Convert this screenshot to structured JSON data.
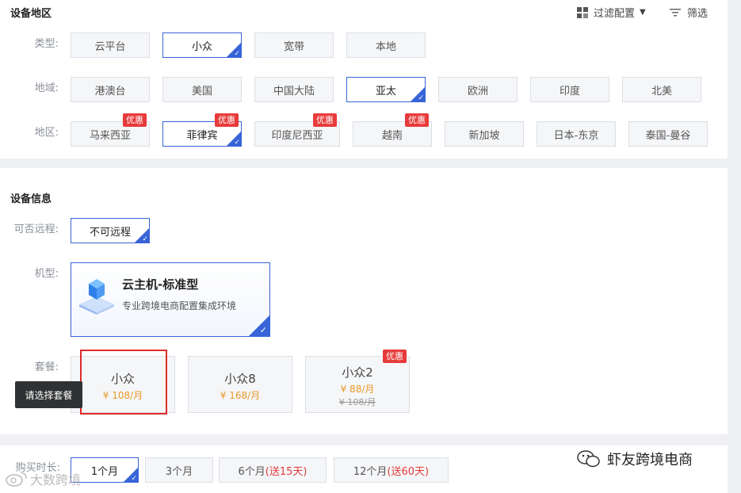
{
  "region_section": {
    "title": "设备地区",
    "filter_config_label": "过滤配置",
    "filter_label": "筛选",
    "type_label": "类型:",
    "types": [
      {
        "label": "云平台",
        "selected": false
      },
      {
        "label": "小众",
        "selected": true
      },
      {
        "label": "宽带",
        "selected": false
      },
      {
        "label": "本地",
        "selected": false
      }
    ],
    "area_label": "地域:",
    "areas": [
      {
        "label": "港澳台",
        "selected": false
      },
      {
        "label": "美国",
        "selected": false
      },
      {
        "label": "中国大陆",
        "selected": false
      },
      {
        "label": "亚太",
        "selected": true
      },
      {
        "label": "欧洲",
        "selected": false
      },
      {
        "label": "印度",
        "selected": false
      },
      {
        "label": "北美",
        "selected": false
      }
    ],
    "district_label": "地区:",
    "districts": [
      {
        "label": "马来西亚",
        "badge": "优惠",
        "selected": false
      },
      {
        "label": "菲律宾",
        "badge": "优惠",
        "selected": true
      },
      {
        "label": "印度尼西亚",
        "badge": "优惠",
        "selected": false
      },
      {
        "label": "越南",
        "badge": "优惠",
        "selected": false
      },
      {
        "label": "新加坡",
        "badge": "",
        "selected": false
      },
      {
        "label": "日本-东京",
        "badge": "",
        "selected": false
      },
      {
        "label": "泰国-曼谷",
        "badge": "",
        "selected": false
      }
    ]
  },
  "device_section": {
    "title": "设备信息",
    "remote_label": "可否远程:",
    "remote_value": "不可远程",
    "model_label": "机型:",
    "model": {
      "name": "云主机-标准型",
      "desc": "专业跨境电商配置集成环境"
    },
    "package_label": "套餐:",
    "packages": [
      {
        "name": "小众",
        "price": "¥ 108/月",
        "old_price": "",
        "badge": ""
      },
      {
        "name": "小众8",
        "price": "¥ 168/月",
        "old_price": "",
        "badge": ""
      },
      {
        "name": "小众2",
        "price": "¥ 88/月",
        "old_price": "¥ 108/月",
        "badge": "优惠"
      }
    ],
    "tooltip": "请选择套餐"
  },
  "duration_section": {
    "label": "购买时长:",
    "options": [
      {
        "label": "1个月",
        "extra": "",
        "selected": true
      },
      {
        "label": "3个月",
        "extra": "",
        "selected": false
      },
      {
        "label": "6个月",
        "extra": "(送15天)",
        "selected": false
      },
      {
        "label": "12个月",
        "extra": "(送60天)",
        "selected": false
      }
    ]
  },
  "watermarks": {
    "wechat": "虾友跨境电商",
    "weibo": "大数跨境"
  },
  "colors": {
    "accent": "#3864d8",
    "badge": "#e83a3a",
    "price": "#e89a2c",
    "highlight_box": "#e02a2a"
  }
}
